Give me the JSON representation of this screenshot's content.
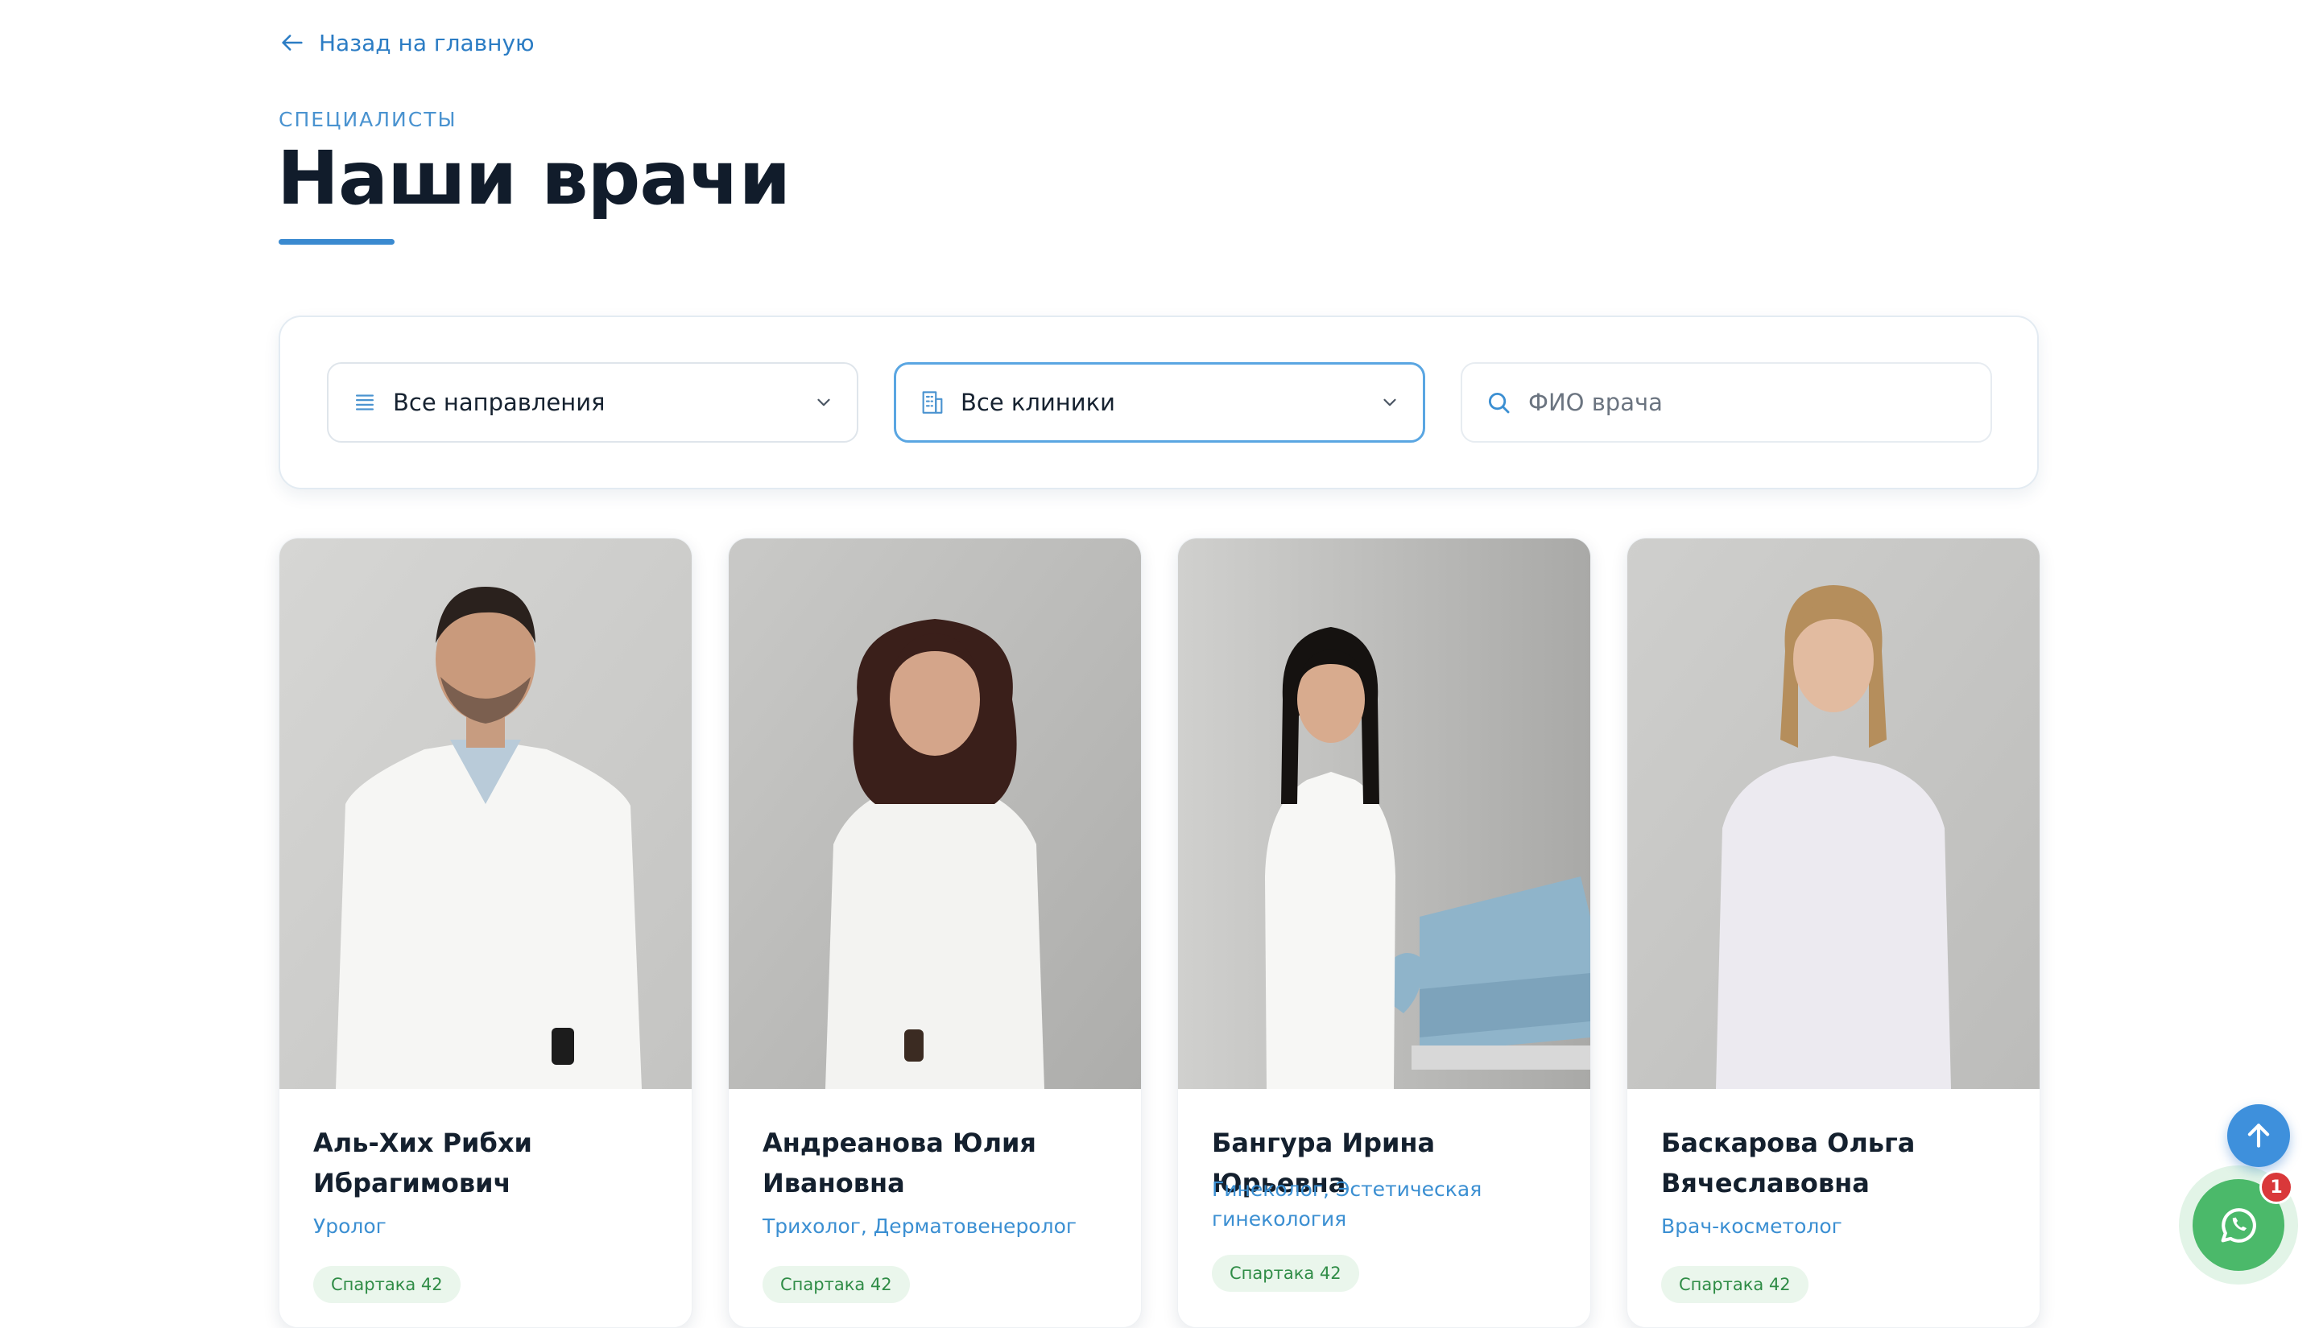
{
  "nav": {
    "back_label": "Назад на главную"
  },
  "header": {
    "eyebrow": "СПЕЦИАЛИСТЫ",
    "title": "Наши врачи"
  },
  "filters": {
    "direction": {
      "value": "Все направления"
    },
    "clinic": {
      "value": "Все клиники"
    },
    "search": {
      "placeholder": "ФИО врача",
      "value": ""
    }
  },
  "doctors": [
    {
      "name": "Аль-Хих Рибхи Ибрагимович",
      "specialty": "Уролог",
      "address": "Спартака 42"
    },
    {
      "name": "Андреанова Юлия Ивановна",
      "specialty": "Трихолог, Дерматовенеролог",
      "address": "Спартака 42"
    },
    {
      "name": "Бангура Ирина Юрьевна",
      "specialty": "Гинеколог, Эстетическая гинекология",
      "address": "Спартака 42"
    },
    {
      "name": "Баскарова Ольга Вячеславовна",
      "specialty": "Врач-косметолог",
      "address": "Спартака 42"
    }
  ],
  "widgets": {
    "chat_badge": "1"
  },
  "colors": {
    "accent": "#3a8ad0",
    "badge_bg": "#eaf6ec",
    "badge_text": "#2f8c46",
    "whatsapp": "#4bb96a",
    "notification": "#d9383a"
  },
  "icons": [
    "arrow-left-icon",
    "list-icon",
    "building-icon",
    "chevron-down-icon",
    "search-icon",
    "arrow-up-icon",
    "whatsapp-icon"
  ]
}
